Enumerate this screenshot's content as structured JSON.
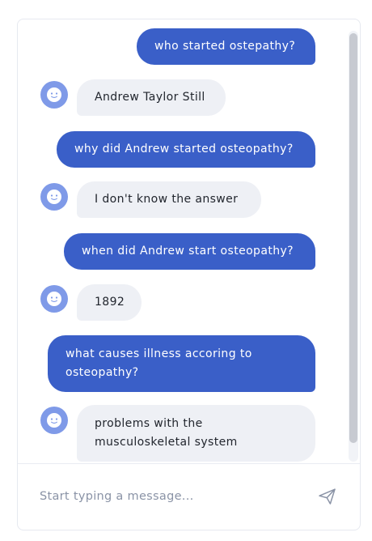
{
  "conversation": {
    "messages": [
      {
        "role": "user",
        "text": "who started ostepathy?"
      },
      {
        "role": "bot",
        "text": "Andrew Taylor Still"
      },
      {
        "role": "user",
        "text": "why did Andrew started osteopathy?"
      },
      {
        "role": "bot",
        "text": "I don't know the answer"
      },
      {
        "role": "user",
        "text": "when did Andrew start osteopathy?"
      },
      {
        "role": "bot",
        "text": "1892"
      },
      {
        "role": "user",
        "text": "what causes illness accoring to osteopathy?"
      },
      {
        "role": "bot",
        "text": "problems with the musculoskeletal system"
      }
    ]
  },
  "composer": {
    "placeholder": "Start typing a message...",
    "send_icon": "paper-plane-icon"
  },
  "colors": {
    "user_bubble": "#3a5fc8",
    "bot_bubble": "#eef0f5",
    "avatar": "#7f9ae8"
  }
}
